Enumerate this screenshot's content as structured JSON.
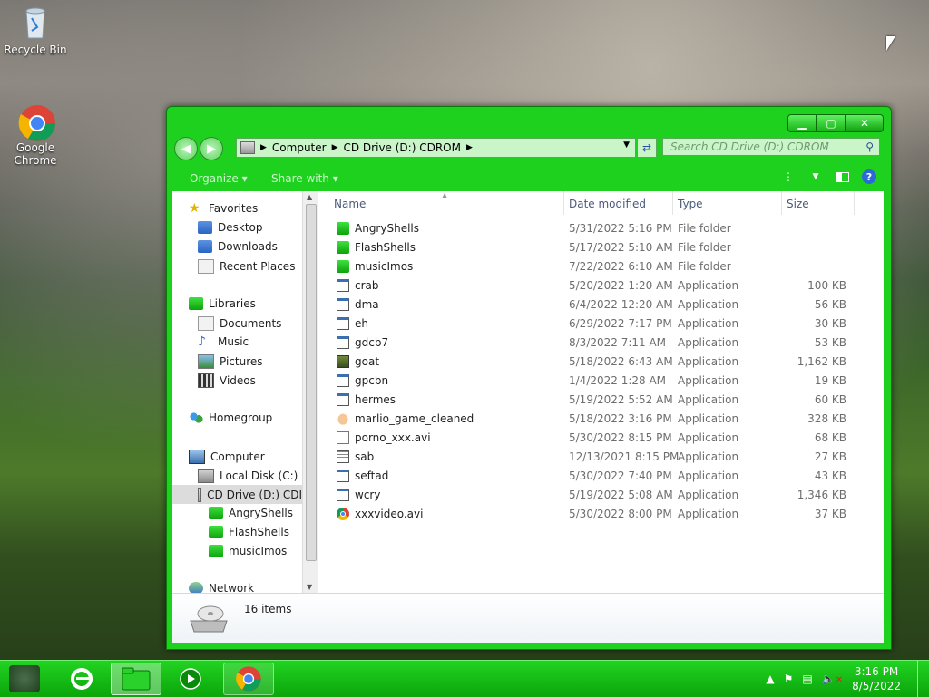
{
  "desktop": {
    "icons": [
      {
        "label": "Recycle Bin"
      },
      {
        "label": "Google\nChrome"
      }
    ]
  },
  "window": {
    "controls": {
      "minimize": "▁",
      "maximize": "▢",
      "close": "✕"
    },
    "address": {
      "crumbs": [
        "Computer",
        "CD Drive (D:) CDROM"
      ]
    },
    "search": {
      "placeholder": "Search CD Drive (D:) CDROM"
    },
    "toolbar": {
      "organize": "Organize ▾",
      "share_with": "Share with ▾"
    },
    "nav": {
      "favorites": "Favorites",
      "desktop": "Desktop",
      "downloads": "Downloads",
      "recent_places": "Recent Places",
      "libraries": "Libraries",
      "documents": "Documents",
      "music": "Music",
      "pictures": "Pictures",
      "videos": "Videos",
      "homegroup": "Homegroup",
      "computer": "Computer",
      "local_disk": "Local Disk (C:)",
      "cd_drive": "CD Drive (D:) CDI",
      "sub_angry": "AngryShells",
      "sub_flash": "FlashShells",
      "sub_music": "musicImos",
      "network": "Network"
    },
    "columns": {
      "name": "Name",
      "date": "Date modified",
      "type": "Type",
      "size": "Size"
    },
    "files": [
      {
        "name": "AngryShells",
        "date": "5/31/2022 5:16 PM",
        "type": "File folder",
        "size": "",
        "icon": "folder"
      },
      {
        "name": "FlashShells",
        "date": "5/17/2022 5:10 AM",
        "type": "File folder",
        "size": "",
        "icon": "folder"
      },
      {
        "name": "musicImos",
        "date": "7/22/2022 6:10 AM",
        "type": "File folder",
        "size": "",
        "icon": "folder"
      },
      {
        "name": "crab",
        "date": "5/20/2022 1:20 AM",
        "type": "Application",
        "size": "100 KB",
        "icon": "app"
      },
      {
        "name": "dma",
        "date": "6/4/2022 12:20 AM",
        "type": "Application",
        "size": "56 KB",
        "icon": "app"
      },
      {
        "name": "eh",
        "date": "6/29/2022 7:17 PM",
        "type": "Application",
        "size": "30 KB",
        "icon": "app"
      },
      {
        "name": "gdcb7",
        "date": "8/3/2022 7:11 AM",
        "type": "Application",
        "size": "53 KB",
        "icon": "app"
      },
      {
        "name": "goat",
        "date": "5/18/2022 6:43 AM",
        "type": "Application",
        "size": "1,162 KB",
        "icon": "goat"
      },
      {
        "name": "gpcbn",
        "date": "1/4/2022 1:28 AM",
        "type": "Application",
        "size": "19 KB",
        "icon": "app"
      },
      {
        "name": "hermes",
        "date": "5/19/2022 5:52 AM",
        "type": "Application",
        "size": "60 KB",
        "icon": "app"
      },
      {
        "name": "marlio_game_cleaned",
        "date": "5/18/2022 3:16 PM",
        "type": "Application",
        "size": "328 KB",
        "icon": "egg"
      },
      {
        "name": "porno_xxx.avi",
        "date": "5/30/2022 8:15 PM",
        "type": "Application",
        "size": "68 KB",
        "icon": "avi"
      },
      {
        "name": "sab",
        "date": "12/13/2021 8:15 PM",
        "type": "Application",
        "size": "27 KB",
        "icon": "sab"
      },
      {
        "name": "seftad",
        "date": "5/30/2022 7:40 PM",
        "type": "Application",
        "size": "43 KB",
        "icon": "app"
      },
      {
        "name": "wcry",
        "date": "5/19/2022 5:08 AM",
        "type": "Application",
        "size": "1,346 KB",
        "icon": "app"
      },
      {
        "name": "xxxvideo.avi",
        "date": "5/30/2022 8:00 PM",
        "type": "Application",
        "size": "37 KB",
        "icon": "chrome"
      }
    ],
    "status": {
      "count": "16 items"
    }
  },
  "taskbar": {
    "clock": {
      "time": "3:16 PM",
      "date": "8/5/2022"
    },
    "tray_arrow": "▲"
  },
  "colors": {
    "accent": "#1fd11f",
    "taskbar": "#0aa50a"
  }
}
